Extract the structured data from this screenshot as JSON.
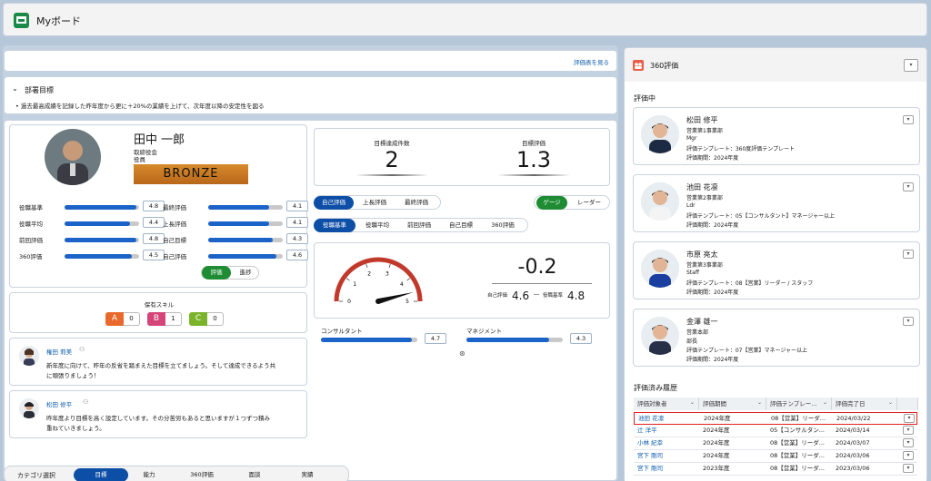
{
  "header": {
    "title": "Myボード"
  },
  "evaluation_link": "評価表を見る",
  "dept": {
    "title": "部署目標",
    "goal": "過去最高成績を記録した昨年度から更に＋20%の業績を上げて、次年度以降の安定性を図る"
  },
  "profile": {
    "name": "田中 一郎",
    "role1": "取締役会",
    "role2": "役員",
    "rank": "BRONZE"
  },
  "left_metrics": [
    {
      "label": "役職基準",
      "value": "4.8",
      "fill": 0.96
    },
    {
      "label": "役職平均",
      "value": "4.4",
      "fill": 0.88
    },
    {
      "label": "前回評価",
      "value": "4.8",
      "fill": 0.96
    },
    {
      "label": "360評価",
      "value": "4.5",
      "fill": 0.9
    }
  ],
  "right_metrics": [
    {
      "label": "最終評価",
      "value": "4.1",
      "fill": 0.82
    },
    {
      "label": "上長評価",
      "value": "4.1",
      "fill": 0.82
    },
    {
      "label": "自己目標",
      "value": "4.3",
      "fill": 0.86
    },
    {
      "label": "自己評価",
      "value": "4.6",
      "fill": 0.92
    }
  ],
  "toggle": {
    "eval": "評価",
    "progress": "進捗"
  },
  "skills": {
    "title": "保有スキル",
    "items": [
      {
        "grade": "A",
        "count": "0",
        "color": "#e8692b"
      },
      {
        "grade": "B",
        "count": "1",
        "color": "#d64577"
      },
      {
        "grade": "C",
        "count": "0",
        "color": "#7bb42a"
      }
    ]
  },
  "comments": [
    {
      "name": "権田 莉美",
      "text1": "新年度に向けて、昨年の反省を踏まえた目標を立てましょう。そして達成できるよう共",
      "text2": "に頑張りましょう！"
    },
    {
      "name": "松田 修平",
      "text1": "昨年度より目標を高く設定しています。その分苦労もあると思いますが１つずつ積み",
      "text2": "重ねていきましょう。"
    }
  ],
  "stats": {
    "goal_count_label": "目標達成件数",
    "goal_count": "2",
    "goal_eval_label": "目標評価",
    "goal_eval": "1.3"
  },
  "tabs1": [
    "自己評価",
    "上長評価",
    "最終評価"
  ],
  "view_tabs": [
    "ゲージ",
    "レーダー"
  ],
  "tabs2": [
    "役職基準",
    "役職平均",
    "前回評価",
    "自己目標",
    "360評価"
  ],
  "gauge": {
    "ticks": [
      "0",
      "1",
      "2",
      "3",
      "4",
      "5"
    ],
    "value": 4.6,
    "diff": "-0.2",
    "self_label": "自己評価",
    "self_value": "4.6",
    "std_label": "役職基準",
    "std_value": "4.8",
    "sep": "―"
  },
  "small_metrics": [
    {
      "label": "コンサルタント",
      "value": "4.7",
      "fill": 0.94
    },
    {
      "label": "マネジメント",
      "value": "4.3",
      "fill": 0.86
    }
  ],
  "category": {
    "label": "カテゴリ選択",
    "tabs": [
      "目標",
      "能力",
      "360評価",
      "面談",
      "実績"
    ]
  },
  "panel360": {
    "title": "360評価",
    "in_progress": "評価中",
    "history_title": "評価済み履歴",
    "people": [
      {
        "name": "松田 修平",
        "dept": "営業第1事業部",
        "position": "Mgr",
        "template": "評価テンプレート：360度評価テンプレート",
        "period": "評価期間：2024年度"
      },
      {
        "name": "池田 花凛",
        "dept": "営業第2事業部",
        "position": "Ldr",
        "template": "評価テンプレート：05【コンサルタント】マネージャー以上",
        "period": "評価期間：2024年度"
      },
      {
        "name": "市原 亮太",
        "dept": "営業第3事業部",
        "position": "Staff",
        "template": "評価テンプレート：08【営業】リーダー / スタッフ",
        "period": "評価期間：2024年度"
      },
      {
        "name": "金澤 雄一",
        "dept": "営業本部",
        "position": "部長",
        "template": "評価テンプレート：07【営業】マネージャー以上",
        "period": "評価期間：2024年度"
      }
    ],
    "columns": [
      "評価対象者",
      "評価期間",
      "評価テンプレー...",
      "評価完了日"
    ],
    "rows": [
      {
        "target": "池田 花凛",
        "period": "2024年度",
        "template": "08【営業】リーダ...",
        "date": "2024/03/22"
      },
      {
        "target": "辻 洋平",
        "period": "2024年度",
        "template": "05【コンサルタン...",
        "date": "2024/03/14"
      },
      {
        "target": "小林 紀幸",
        "period": "2024年度",
        "template": "08【営業】リーダ...",
        "date": "2024/03/07"
      },
      {
        "target": "宮下 剛司",
        "period": "2024年度",
        "template": "08【営業】リーダ...",
        "date": "2024/03/06"
      },
      {
        "target": "宮下 剛司",
        "period": "2023年度",
        "template": "08【営業】リーダ...",
        "date": "2023/03/06"
      }
    ]
  },
  "colors": {
    "primary": "#0d4ea6",
    "bar": "#1c63c9",
    "green": "#1f8c34",
    "gauge_red": "#c0392b",
    "highlight": "#e02020"
  }
}
